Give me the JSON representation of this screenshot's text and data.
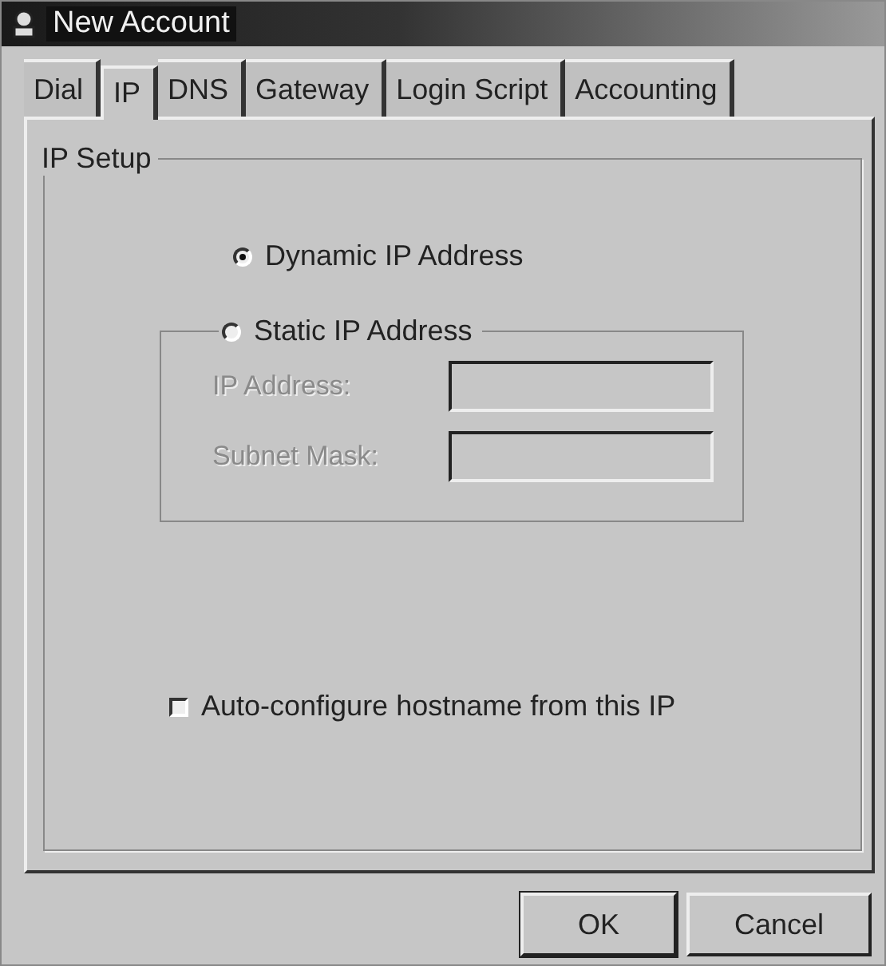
{
  "window": {
    "title": "New Account"
  },
  "tabs": [
    {
      "label": "Dial",
      "selected": false
    },
    {
      "label": "IP",
      "selected": true
    },
    {
      "label": "DNS",
      "selected": false
    },
    {
      "label": "Gateway",
      "selected": false
    },
    {
      "label": "Login Script",
      "selected": false
    },
    {
      "label": "Accounting",
      "selected": false
    }
  ],
  "ip_setup": {
    "title": "IP Setup",
    "radios": [
      {
        "label": "Dynamic IP Address",
        "selected": true
      },
      {
        "label": "Static IP Address",
        "selected": false
      }
    ],
    "static_fields": [
      {
        "label": "IP Address:",
        "disabled": true
      },
      {
        "label": "Subnet Mask:",
        "disabled": true
      }
    ],
    "checkbox": {
      "label": "Auto-configure hostname from this IP",
      "checked": false
    }
  },
  "buttons": [
    "OK",
    "Cancel"
  ]
}
